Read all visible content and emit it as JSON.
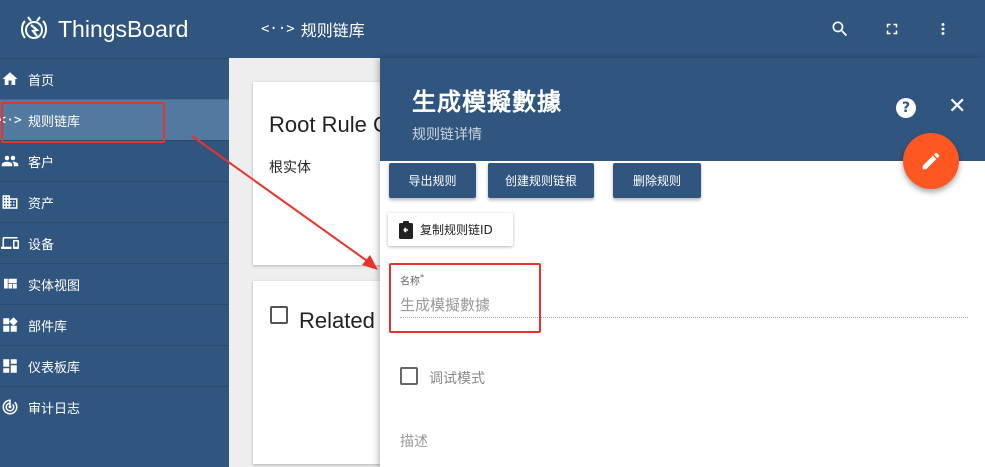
{
  "app": {
    "name": "ThingsBoard"
  },
  "topbar": {
    "code_glyph": "<··>",
    "title": "规则链库"
  },
  "sidebar": {
    "items": [
      {
        "label": "首页",
        "icon": "home-icon"
      },
      {
        "label": "规则链库",
        "icon": "rule-chain-icon",
        "active": true
      },
      {
        "label": "客户",
        "icon": "people-icon"
      },
      {
        "label": "资产",
        "icon": "domain-icon"
      },
      {
        "label": "设备",
        "icon": "devices-icon"
      },
      {
        "label": "实体视图",
        "icon": "view-quilt-icon"
      },
      {
        "label": "部件库",
        "icon": "widgets-icon"
      },
      {
        "label": "仪表板库",
        "icon": "dashboard-icon"
      },
      {
        "label": "审计日志",
        "icon": "track-changes-icon"
      }
    ]
  },
  "cards": [
    {
      "title": "Root Rule C",
      "subtitle": "根实体"
    },
    {
      "title": "Related"
    }
  ],
  "panel": {
    "title": "生成模擬數據",
    "subtitle": "规则链详情",
    "buttons": {
      "export": "导出规则",
      "make_root": "创建规则链根",
      "delete": "删除规则"
    },
    "copy_id": "复制规则链ID",
    "name_field": {
      "label": "名称",
      "required": "*",
      "value": "生成模擬數據"
    },
    "debug_mode": "调试模式",
    "description": "描述"
  },
  "colors": {
    "primary": "#305680",
    "active": "#527aa0",
    "fab": "#ff5722",
    "annotation": "#e8322d"
  }
}
